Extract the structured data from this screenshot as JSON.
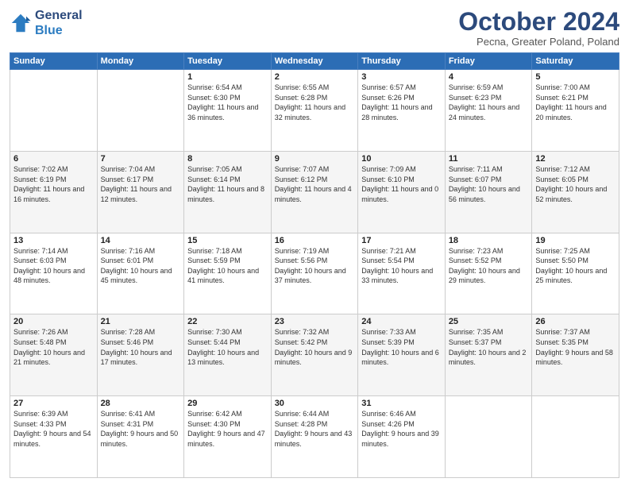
{
  "logo": {
    "line1": "General",
    "line2": "Blue"
  },
  "title": "October 2024",
  "subtitle": "Pecna, Greater Poland, Poland",
  "header_days": [
    "Sunday",
    "Monday",
    "Tuesday",
    "Wednesday",
    "Thursday",
    "Friday",
    "Saturday"
  ],
  "weeks": [
    [
      {
        "day": "",
        "sunrise": "",
        "sunset": "",
        "daylight": ""
      },
      {
        "day": "",
        "sunrise": "",
        "sunset": "",
        "daylight": ""
      },
      {
        "day": "1",
        "sunrise": "Sunrise: 6:54 AM",
        "sunset": "Sunset: 6:30 PM",
        "daylight": "Daylight: 11 hours and 36 minutes."
      },
      {
        "day": "2",
        "sunrise": "Sunrise: 6:55 AM",
        "sunset": "Sunset: 6:28 PM",
        "daylight": "Daylight: 11 hours and 32 minutes."
      },
      {
        "day": "3",
        "sunrise": "Sunrise: 6:57 AM",
        "sunset": "Sunset: 6:26 PM",
        "daylight": "Daylight: 11 hours and 28 minutes."
      },
      {
        "day": "4",
        "sunrise": "Sunrise: 6:59 AM",
        "sunset": "Sunset: 6:23 PM",
        "daylight": "Daylight: 11 hours and 24 minutes."
      },
      {
        "day": "5",
        "sunrise": "Sunrise: 7:00 AM",
        "sunset": "Sunset: 6:21 PM",
        "daylight": "Daylight: 11 hours and 20 minutes."
      }
    ],
    [
      {
        "day": "6",
        "sunrise": "Sunrise: 7:02 AM",
        "sunset": "Sunset: 6:19 PM",
        "daylight": "Daylight: 11 hours and 16 minutes."
      },
      {
        "day": "7",
        "sunrise": "Sunrise: 7:04 AM",
        "sunset": "Sunset: 6:17 PM",
        "daylight": "Daylight: 11 hours and 12 minutes."
      },
      {
        "day": "8",
        "sunrise": "Sunrise: 7:05 AM",
        "sunset": "Sunset: 6:14 PM",
        "daylight": "Daylight: 11 hours and 8 minutes."
      },
      {
        "day": "9",
        "sunrise": "Sunrise: 7:07 AM",
        "sunset": "Sunset: 6:12 PM",
        "daylight": "Daylight: 11 hours and 4 minutes."
      },
      {
        "day": "10",
        "sunrise": "Sunrise: 7:09 AM",
        "sunset": "Sunset: 6:10 PM",
        "daylight": "Daylight: 11 hours and 0 minutes."
      },
      {
        "day": "11",
        "sunrise": "Sunrise: 7:11 AM",
        "sunset": "Sunset: 6:07 PM",
        "daylight": "Daylight: 10 hours and 56 minutes."
      },
      {
        "day": "12",
        "sunrise": "Sunrise: 7:12 AM",
        "sunset": "Sunset: 6:05 PM",
        "daylight": "Daylight: 10 hours and 52 minutes."
      }
    ],
    [
      {
        "day": "13",
        "sunrise": "Sunrise: 7:14 AM",
        "sunset": "Sunset: 6:03 PM",
        "daylight": "Daylight: 10 hours and 48 minutes."
      },
      {
        "day": "14",
        "sunrise": "Sunrise: 7:16 AM",
        "sunset": "Sunset: 6:01 PM",
        "daylight": "Daylight: 10 hours and 45 minutes."
      },
      {
        "day": "15",
        "sunrise": "Sunrise: 7:18 AM",
        "sunset": "Sunset: 5:59 PM",
        "daylight": "Daylight: 10 hours and 41 minutes."
      },
      {
        "day": "16",
        "sunrise": "Sunrise: 7:19 AM",
        "sunset": "Sunset: 5:56 PM",
        "daylight": "Daylight: 10 hours and 37 minutes."
      },
      {
        "day": "17",
        "sunrise": "Sunrise: 7:21 AM",
        "sunset": "Sunset: 5:54 PM",
        "daylight": "Daylight: 10 hours and 33 minutes."
      },
      {
        "day": "18",
        "sunrise": "Sunrise: 7:23 AM",
        "sunset": "Sunset: 5:52 PM",
        "daylight": "Daylight: 10 hours and 29 minutes."
      },
      {
        "day": "19",
        "sunrise": "Sunrise: 7:25 AM",
        "sunset": "Sunset: 5:50 PM",
        "daylight": "Daylight: 10 hours and 25 minutes."
      }
    ],
    [
      {
        "day": "20",
        "sunrise": "Sunrise: 7:26 AM",
        "sunset": "Sunset: 5:48 PM",
        "daylight": "Daylight: 10 hours and 21 minutes."
      },
      {
        "day": "21",
        "sunrise": "Sunrise: 7:28 AM",
        "sunset": "Sunset: 5:46 PM",
        "daylight": "Daylight: 10 hours and 17 minutes."
      },
      {
        "day": "22",
        "sunrise": "Sunrise: 7:30 AM",
        "sunset": "Sunset: 5:44 PM",
        "daylight": "Daylight: 10 hours and 13 minutes."
      },
      {
        "day": "23",
        "sunrise": "Sunrise: 7:32 AM",
        "sunset": "Sunset: 5:42 PM",
        "daylight": "Daylight: 10 hours and 9 minutes."
      },
      {
        "day": "24",
        "sunrise": "Sunrise: 7:33 AM",
        "sunset": "Sunset: 5:39 PM",
        "daylight": "Daylight: 10 hours and 6 minutes."
      },
      {
        "day": "25",
        "sunrise": "Sunrise: 7:35 AM",
        "sunset": "Sunset: 5:37 PM",
        "daylight": "Daylight: 10 hours and 2 minutes."
      },
      {
        "day": "26",
        "sunrise": "Sunrise: 7:37 AM",
        "sunset": "Sunset: 5:35 PM",
        "daylight": "Daylight: 9 hours and 58 minutes."
      }
    ],
    [
      {
        "day": "27",
        "sunrise": "Sunrise: 6:39 AM",
        "sunset": "Sunset: 4:33 PM",
        "daylight": "Daylight: 9 hours and 54 minutes."
      },
      {
        "day": "28",
        "sunrise": "Sunrise: 6:41 AM",
        "sunset": "Sunset: 4:31 PM",
        "daylight": "Daylight: 9 hours and 50 minutes."
      },
      {
        "day": "29",
        "sunrise": "Sunrise: 6:42 AM",
        "sunset": "Sunset: 4:30 PM",
        "daylight": "Daylight: 9 hours and 47 minutes."
      },
      {
        "day": "30",
        "sunrise": "Sunrise: 6:44 AM",
        "sunset": "Sunset: 4:28 PM",
        "daylight": "Daylight: 9 hours and 43 minutes."
      },
      {
        "day": "31",
        "sunrise": "Sunrise: 6:46 AM",
        "sunset": "Sunset: 4:26 PM",
        "daylight": "Daylight: 9 hours and 39 minutes."
      },
      {
        "day": "",
        "sunrise": "",
        "sunset": "",
        "daylight": ""
      },
      {
        "day": "",
        "sunrise": "",
        "sunset": "",
        "daylight": ""
      }
    ]
  ]
}
